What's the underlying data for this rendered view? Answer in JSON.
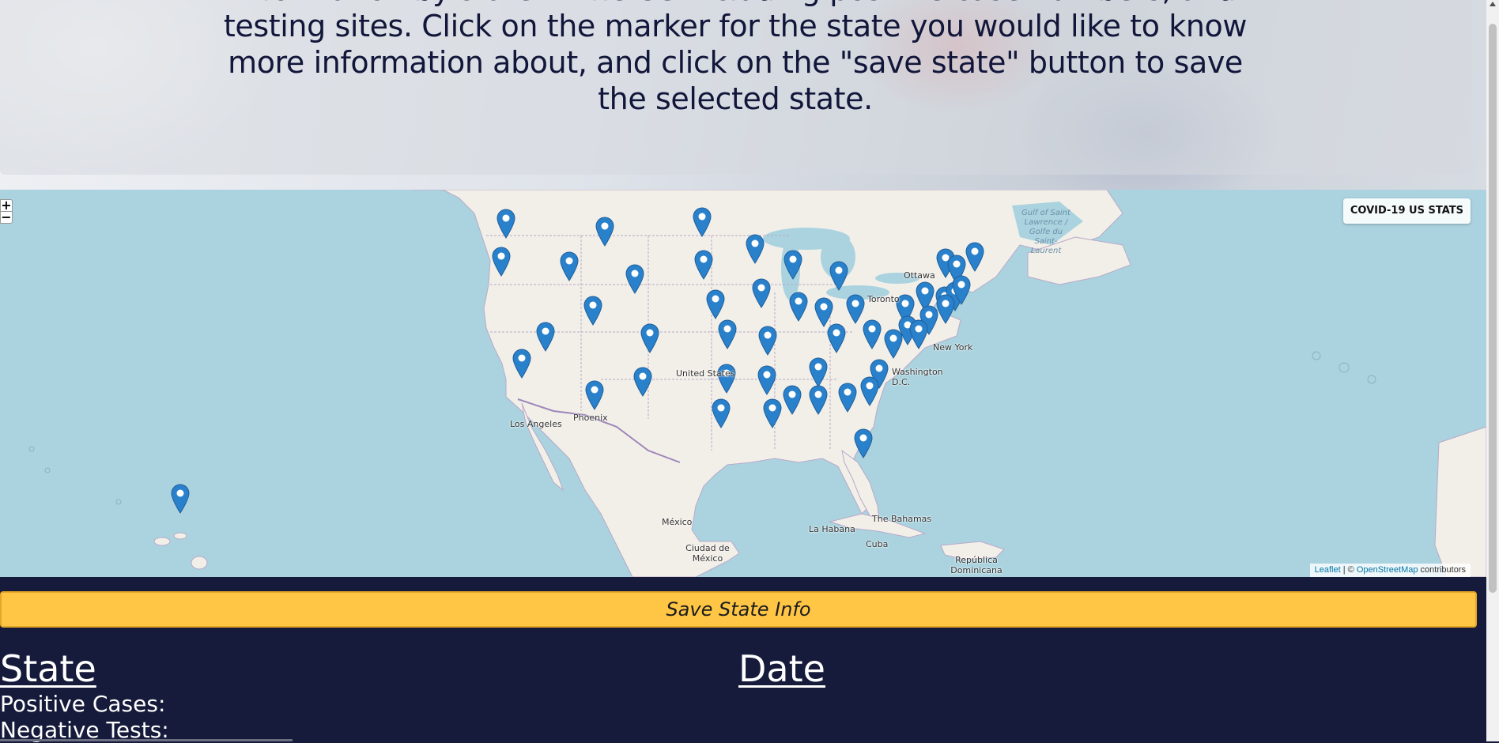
{
  "intro": {
    "text": "information by state in the US including positive case numbers, and testing sites. Click on the marker for the state you would like to know more information about, and click on the \"save state\" button to save the selected state."
  },
  "map": {
    "title": "COVID-19 US STATS",
    "zoom_in": "+",
    "zoom_out": "−",
    "attribution": {
      "leaflet": "Leaflet",
      "separator": " | © ",
      "osm": "OpenStreetMap",
      "suffix": " contributors"
    },
    "cities": [
      "Ottawa",
      "Toronto",
      "New York",
      "Washington D.C.",
      "Los Angeles",
      "Phoenix",
      "United States",
      "México",
      "Ciudad de México",
      "La Habana",
      "Cuba",
      "The Bahamas",
      "República Dominicana"
    ],
    "water_labels": [
      "Gulf of Saint Lawrence / Golfe du Saint-Laurent"
    ],
    "marker_count": 50,
    "marker_color": "#2a81cb"
  },
  "save_button": "Save State Info",
  "results": {
    "state_heading": "State",
    "date_heading": "Date",
    "positive_label": "Positive Cases:",
    "negative_label": "Negative Tests:"
  },
  "colors": {
    "page_background": "#161b3b",
    "button": "#ffc645",
    "map_water": "#aad3df",
    "map_land": "#f2efe9"
  }
}
